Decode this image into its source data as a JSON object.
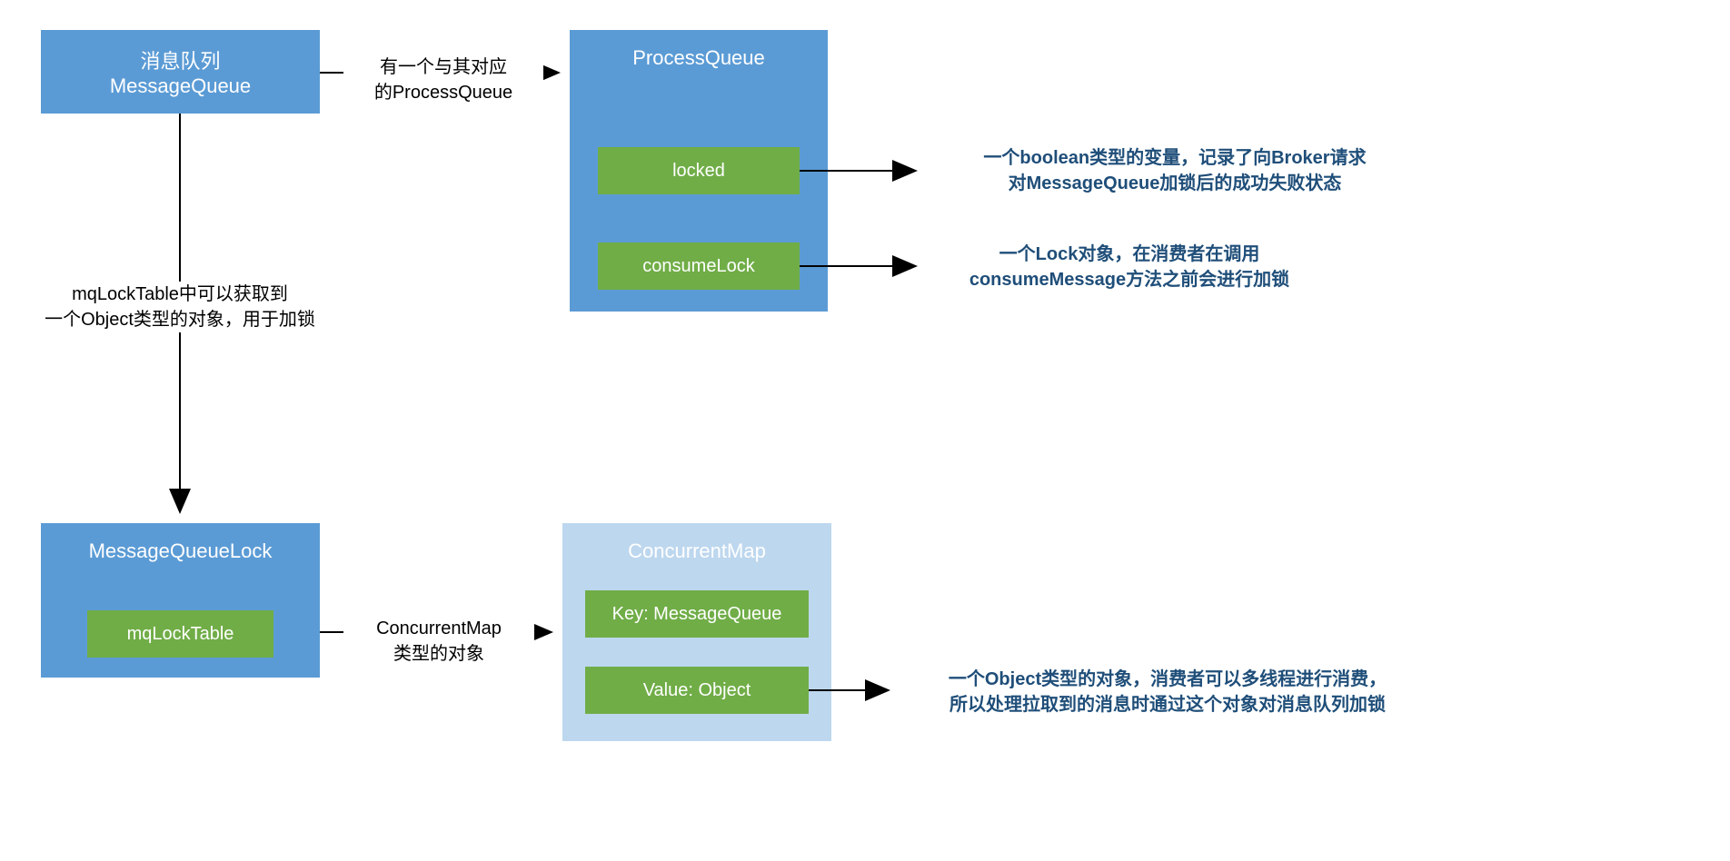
{
  "msgQueue": {
    "title_line1": "消息队列",
    "title_line2": "MessageQueue"
  },
  "processQueue": {
    "title": "ProcessQueue",
    "locked": "locked",
    "consumeLock": "consumeLock"
  },
  "mqLock": {
    "title": "MessageQueueLock",
    "mqLockTable": "mqLockTable"
  },
  "concurrentMap": {
    "title": "ConcurrentMap",
    "key": "Key: MessageQueue",
    "value": "Value: Object"
  },
  "edge": {
    "hasProcessQueue_l1": "有一个与其对应",
    "hasProcessQueue_l2": "的ProcessQueue",
    "mqLockTable_l1": "mqLockTable中可以获取到",
    "mqLockTable_l2": "一个Object类型的对象，用于加锁",
    "concurrentMap_l1": "ConcurrentMap",
    "concurrentMap_l2": "类型的对象"
  },
  "note": {
    "locked_l1": "一个boolean类型的变量，记录了向Broker请求",
    "locked_l2": "对MessageQueue加锁后的成功失败状态",
    "consumeLock_l1": "一个Lock对象，在消费者在调用",
    "consumeLock_l2": "consumeMessage方法之前会进行加锁",
    "valueObj_l1": "一个Object类型的对象，消费者可以多线程进行消费，",
    "valueObj_l2": "所以处理拉取到的消息时通过这个对象对消息队列加锁"
  }
}
